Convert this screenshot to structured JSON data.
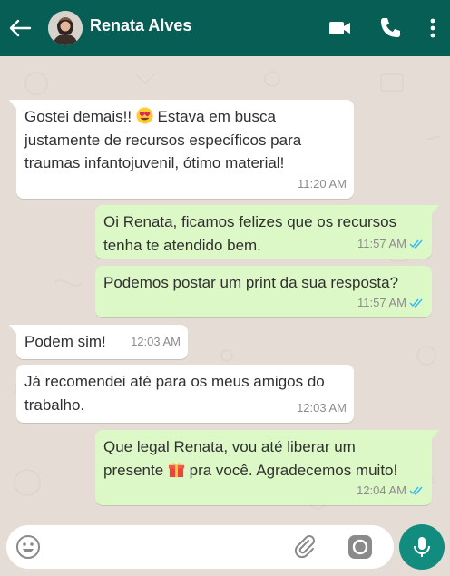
{
  "header": {
    "contact_name": "Renata Alves",
    "icons": [
      "back-arrow-icon",
      "avatar",
      "video-call-icon",
      "phone-icon",
      "more-vert-icon"
    ]
  },
  "colors": {
    "header_bg": "#075e54",
    "chat_bg": "#e5ddd5",
    "incoming_bubble": "#ffffff",
    "outgoing_bubble": "#dcf8c6",
    "read_tick": "#34b7f1",
    "mic_button": "#128c7e"
  },
  "messages": [
    {
      "direction": "in",
      "lines": [
        "Gostei demais!! ",
        " Estava em busca",
        "justamente de recursos específicos para",
        "traumas infantojuvenil, ótimo material!"
      ],
      "emoji": "heart-eyes-emoji",
      "time": "11:20 AM"
    },
    {
      "direction": "out",
      "lines": [
        "Oi Renata, ficamos felizes que os recursos",
        "tenha te atendido bem."
      ],
      "time": "11:57 AM",
      "status": "read"
    },
    {
      "direction": "out",
      "lines": [
        "Podemos postar um print da sua resposta?"
      ],
      "time": "11:57 AM",
      "status": "read"
    },
    {
      "direction": "in",
      "lines": [
        "Podem sim!"
      ],
      "time": "12:03 AM"
    },
    {
      "direction": "in",
      "lines": [
        "Já recomendei até para os meus amigos do",
        "trabalho."
      ],
      "time": "12:03 AM"
    },
    {
      "direction": "out",
      "lines": [
        "Que legal Renata, vou até liberar um",
        "presente ",
        " pra você. Agradecemos muito!"
      ],
      "emoji": "gift-emoji",
      "time": "12:04 AM",
      "status": "read"
    }
  ],
  "footer": {
    "icons": [
      "emoji-icon",
      "attach-icon",
      "camera-icon",
      "mic-icon"
    ]
  }
}
